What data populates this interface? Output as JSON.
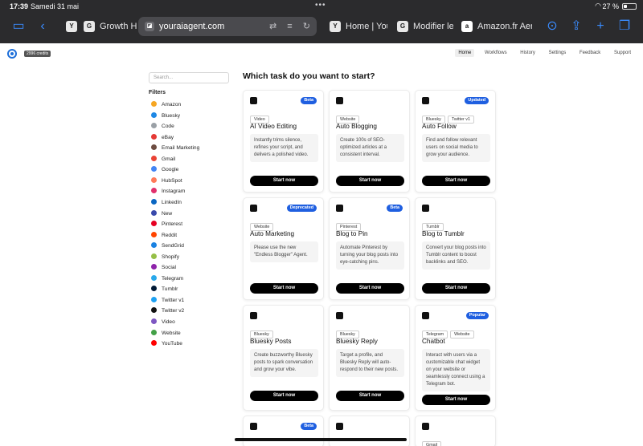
{
  "status_bar": {
    "time": "17:39",
    "date": "Samedi 31 mai",
    "battery": "27 %"
  },
  "browser": {
    "tabs": [
      {
        "favicon": "Y",
        "title": ""
      },
      {
        "favicon": "G",
        "title": "Growth Hac"
      },
      {
        "favicon": "Y",
        "title": "Home | Your"
      },
      {
        "favicon": "G",
        "title": "Modifier le c"
      },
      {
        "favicon": "a",
        "title": "Amazon.fr Aersa"
      }
    ],
    "active_url": "youraiagent.com"
  },
  "app": {
    "credits": "2996 credits",
    "nav": [
      "Home",
      "Workflows",
      "History",
      "Settings",
      "Feedback",
      "Support"
    ]
  },
  "sidebar": {
    "search_placeholder": "Search...",
    "filters_title": "Filters",
    "filters": [
      {
        "label": "Amazon",
        "color": "#f5a623"
      },
      {
        "label": "Bluesky",
        "color": "#1e88e5"
      },
      {
        "label": "Code",
        "color": "#9aa0a6"
      },
      {
        "label": "eBay",
        "color": "#e53935"
      },
      {
        "label": "Email Marketing",
        "color": "#6d4c41"
      },
      {
        "label": "Gmail",
        "color": "#ea4335"
      },
      {
        "label": "Google",
        "color": "#4285f4"
      },
      {
        "label": "HubSpot",
        "color": "#ff7a59"
      },
      {
        "label": "Instagram",
        "color": "#e1306c"
      },
      {
        "label": "LinkedIn",
        "color": "#0a66c2"
      },
      {
        "label": "New",
        "color": "#3949ab"
      },
      {
        "label": "Pinterest",
        "color": "#e60023"
      },
      {
        "label": "Reddit",
        "color": "#ff4500"
      },
      {
        "label": "SendGrid",
        "color": "#1a82e2"
      },
      {
        "label": "Shopify",
        "color": "#95bf47"
      },
      {
        "label": "Social",
        "color": "#8e24aa"
      },
      {
        "label": "Telegram",
        "color": "#29a9eb"
      },
      {
        "label": "Tumblr",
        "color": "#001935"
      },
      {
        "label": "Twitter v1",
        "color": "#1da1f2"
      },
      {
        "label": "Twitter v2",
        "color": "#111111"
      },
      {
        "label": "Video",
        "color": "#7e57c2"
      },
      {
        "label": "Website",
        "color": "#43a047"
      },
      {
        "label": "YouTube",
        "color": "#ff0000"
      }
    ]
  },
  "main": {
    "heading": "Which task do you want to start?",
    "start_label": "Start now",
    "cards": [
      {
        "title": "AI Video Editing",
        "badge": "Beta",
        "badge_color": "#1f5fe0",
        "tags": [
          "Video"
        ],
        "description": "Instantly trims silence, refines your script, and delivers a polished video."
      },
      {
        "title": "Auto Blogging",
        "badge": "",
        "tags": [
          "Website"
        ],
        "description": "Create 100s of SEO-optimized articles at a consistent interval."
      },
      {
        "title": "Auto Follow",
        "badge": "Updated",
        "badge_color": "#1f5fe0",
        "tags": [
          "Bluesky",
          "Twitter v1"
        ],
        "description": "Find and follow relevant users on social media to grow your audience."
      },
      {
        "title": "Auto Marketing",
        "badge": "Deprecated",
        "badge_color": "#1f5fe0",
        "tags": [
          "Website"
        ],
        "description": "Please use the new \"Endless Blogger\" Agent."
      },
      {
        "title": "Blog to Pin",
        "badge": "Beta",
        "badge_color": "#1f5fe0",
        "tags": [
          "Pinterest"
        ],
        "description": "Automate Pinterest by turning your blog posts into eye-catching pins."
      },
      {
        "title": "Blog to Tumblr",
        "badge": "",
        "tags": [
          "Tumblr"
        ],
        "description": "Convert your blog posts into Tumblr content to boost backlinks and SEO."
      },
      {
        "title": "Bluesky Posts",
        "badge": "",
        "tags": [
          "Bluesky"
        ],
        "description": "Create buzzworthy Bluesky posts to spark conversation and grow your vibe."
      },
      {
        "title": "Bluesky Reply",
        "badge": "",
        "tags": [
          "Bluesky"
        ],
        "description": "Target a profile, and Bluesky Reply will auto-respond to their new posts."
      },
      {
        "title": "Chatbot",
        "badge": "Popular",
        "badge_color": "#1f5fe0",
        "tags": [
          "Telegram",
          "Website"
        ],
        "description": "Interact with users via a customizable chat widget on your website or seamlessly connect using a Telegram bot."
      },
      {
        "title": "",
        "badge": "Beta",
        "badge_color": "#1f5fe0",
        "tags": [],
        "description": ""
      },
      {
        "title": "",
        "badge": "",
        "tags": [],
        "description": ""
      },
      {
        "title": "",
        "badge": "",
        "tags": [
          "Gmail"
        ],
        "description": ""
      }
    ]
  }
}
